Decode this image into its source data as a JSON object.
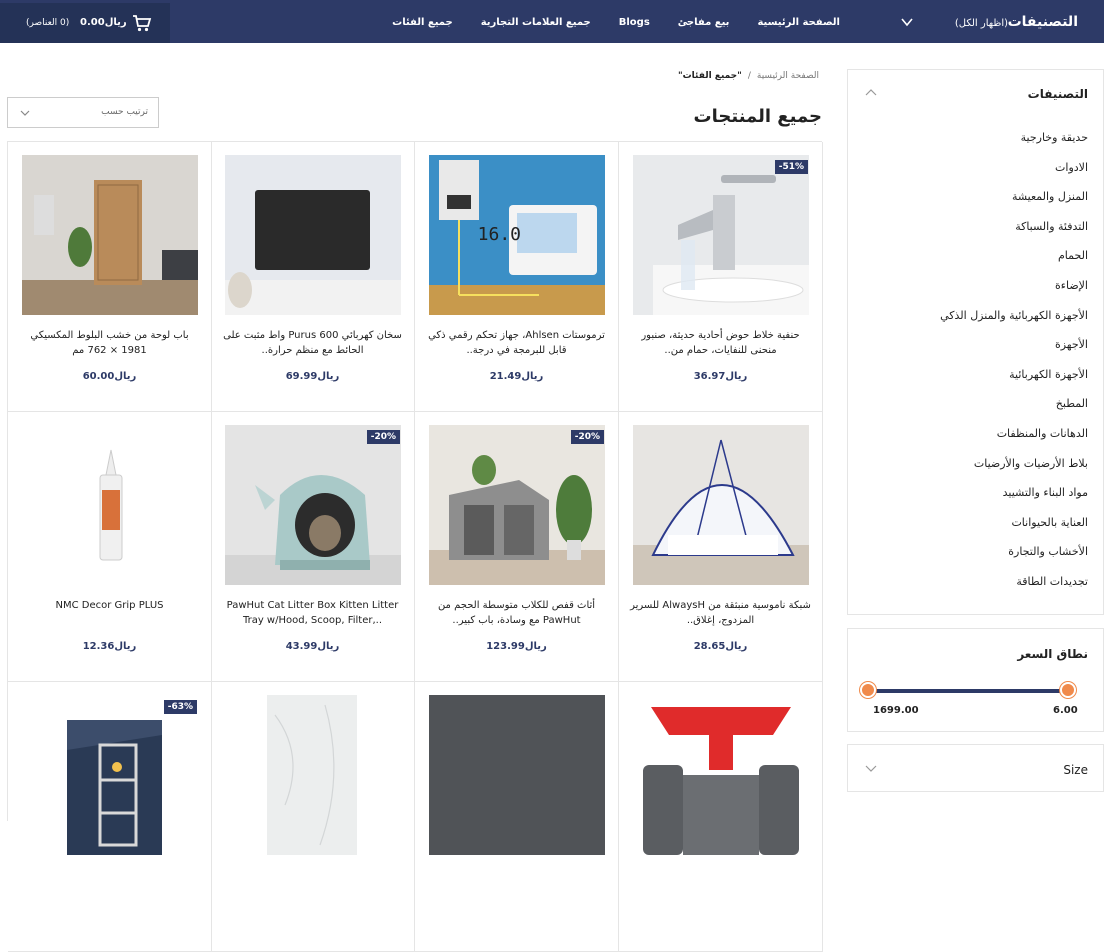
{
  "header": {
    "categories_title": "التصنيفات",
    "show_all": "(اظهار الكل)",
    "nav": [
      "الصفحة الرئيسية",
      "بيع مفاجئ",
      "Blogs",
      "جميع العلامات التجارية",
      "جميع الفئات"
    ],
    "cart_amount": "ريال0.00",
    "cart_items": "(0 العناصر)"
  },
  "sidebar": {
    "categories_title": "التصنيفات",
    "categories": [
      "حديقة وخارجية",
      "الادوات",
      "المنزل والمعيشة",
      "التدفئة والسباكة",
      "الحمام",
      "الإضاءة",
      "الأجهزة الكهربائية والمنزل الذكي",
      "الأجهزة",
      "الأجهزة الكهربائية",
      "المطبخ",
      "الدهانات والمنظفات",
      "بلاط الأرضيات والأرضيات",
      "مواد البناء والتشييد",
      "العناية بالحيوانات",
      "الأخشاب والتجارة",
      "تجديدات الطاقة"
    ],
    "price_title": "نطاق السعر",
    "price_min": "6.00",
    "price_max": "1699.00",
    "size_title": "Size"
  },
  "main": {
    "breadcrumb_home": "الصفحة الرئيسية",
    "breadcrumb_sep": "/",
    "breadcrumb_current": "\"جميع الفئات\"",
    "title": "جميع المنتجات",
    "sort_label": "ترتيب حسب"
  },
  "products": [
    {
      "name": "حنفية خلاط حوض أحادية حديثة، صنبور منحنى للنفايات، حمام من..",
      "price": "ريال36.97",
      "badge": "51%-"
    },
    {
      "name": "ترموستات Ahlsen، جهاز تحكم رقمي ذكي قابل للبرمجة في درجة..",
      "price": "ريال21.49",
      "badge": ""
    },
    {
      "name": "سخان كهربائي Purus 600 واط مثبت على الحائط مع منظم حرارة..",
      "price": "ريال69.99",
      "badge": ""
    },
    {
      "name": "باب لوحة من خشب البلوط المكسيكي 1981 × 762 مم",
      "price": "ريال60.00",
      "badge": ""
    },
    {
      "name": "شبكة ناموسية منبثقة من AlwaysH للسرير المزدوج، إغلاق..",
      "price": "ريال28.65",
      "badge": ""
    },
    {
      "name": "أثاث قفص للكلاب متوسطة الحجم من PawHut مع وسادة، باب كبير..",
      "price": "ريال123.99",
      "badge": "20%-"
    },
    {
      "name": "PawHut Cat Litter Box Kitten Litter Tray w/Hood, Scoop, Filter,..",
      "price": "ريال43.99",
      "badge": "20%-"
    },
    {
      "name": "NMC Decor Grip PLUS",
      "price": "ريال12.36",
      "badge": ""
    },
    {
      "name": "",
      "price": "",
      "badge": ""
    },
    {
      "name": "",
      "price": "",
      "badge": ""
    },
    {
      "name": "",
      "price": "",
      "badge": ""
    },
    {
      "name": "",
      "price": "",
      "badge": "63%-"
    }
  ],
  "colors": {
    "brand_navy": "#2d3a67",
    "slider_knob": "#f08a4b"
  }
}
